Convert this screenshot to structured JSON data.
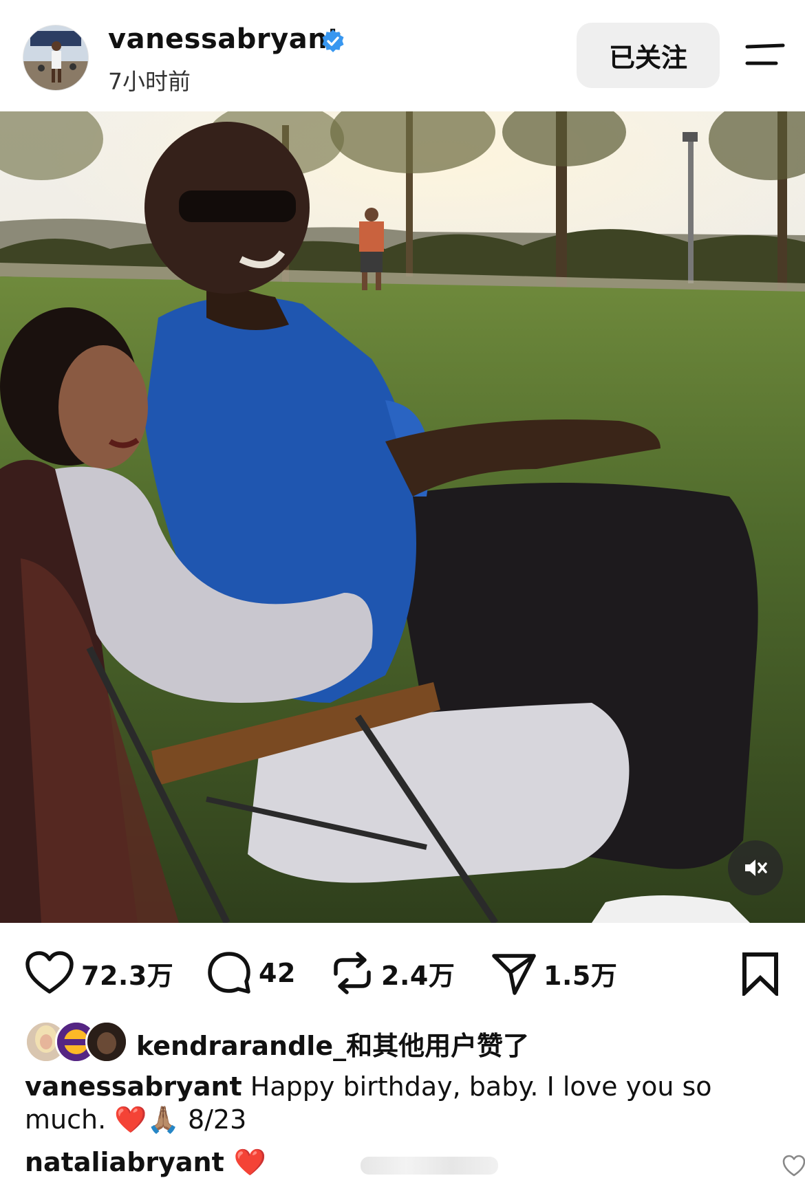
{
  "post": {
    "author": "vanessabryant",
    "verified": true,
    "time_ago": "7小时前",
    "follow_label": "已关注"
  },
  "icons": {
    "header": [
      "verified-badge-icon",
      "menu-icon"
    ],
    "actions": [
      "heart-icon",
      "comment-icon",
      "repost-icon",
      "send-icon",
      "bookmark-icon"
    ],
    "media": [
      "mute-icon"
    ]
  },
  "actions": {
    "likes": "72.3万",
    "comments": "42",
    "reposts": "2.4万",
    "shares": "1.5万"
  },
  "liked_by": {
    "text": "kendrarandle_和其他用户赞了"
  },
  "caption": {
    "user": "vanessabryant",
    "text": "Happy birthday, baby. I love you so much. ❤️🙏🏽 8/23"
  },
  "comment": {
    "user": "nataliabryant",
    "text": "❤️"
  },
  "colors": {
    "verified": "#3897f0",
    "follow_bg": "#efefef",
    "heart_red": "#e0152a"
  }
}
